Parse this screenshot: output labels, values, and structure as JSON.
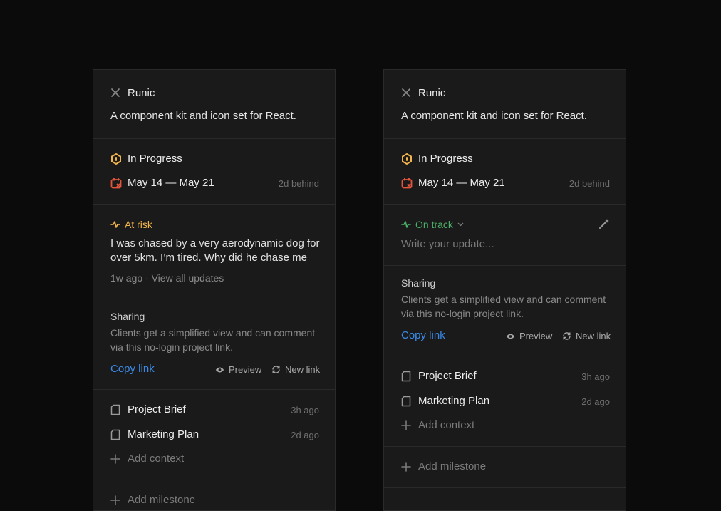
{
  "colors": {
    "background": "#0b0b0b",
    "panel": "#1a1a1a",
    "in_progress": "#f1b34c",
    "date_icon": "#e5553d",
    "at_risk": "#f1b34c",
    "on_track": "#4caf68",
    "link": "#3b8ae8"
  },
  "panels": [
    {
      "project": {
        "name": "Runic",
        "description": "A component kit and icon set for React."
      },
      "status": {
        "label": "In Progress",
        "date_range": "May 14 — May 21",
        "behind": "2d behind"
      },
      "update": {
        "health": "At risk",
        "text_line1": "I was chased by a very aerodynamic dog for",
        "text_line2": "over 5km. I’m tired. Why did he chase me",
        "meta": "1w ago · View all updates"
      },
      "sharing": {
        "title": "Sharing",
        "desc_line1": "Clients get a simplified view and can comment",
        "desc_line2": "via this no-login project link.",
        "copy_link": "Copy link",
        "preview": "Preview",
        "new_link": "New link"
      },
      "files": [
        {
          "name": "Project Brief",
          "time": "3h ago"
        },
        {
          "name": "Marketing Plan",
          "time": "2d ago"
        }
      ],
      "add_context": "Add context",
      "add_milestone": "Add milestone"
    },
    {
      "project": {
        "name": "Runic",
        "description": "A component kit and icon set for React."
      },
      "status": {
        "label": "In Progress",
        "date_range": "May 14 — May 21",
        "behind": "2d behind"
      },
      "update": {
        "health": "On track",
        "placeholder": "Write your update..."
      },
      "sharing": {
        "title": "Sharing",
        "desc_line1": "Clients get a simplified view and can comment",
        "desc_line2": "via this no-login project link.",
        "copy_link": "Copy link",
        "preview": "Preview",
        "new_link": "New link"
      },
      "files": [
        {
          "name": "Project Brief",
          "time": "3h ago"
        },
        {
          "name": "Marketing Plan",
          "time": "2d ago"
        }
      ],
      "add_context": "Add context",
      "add_milestone": "Add milestone"
    }
  ]
}
